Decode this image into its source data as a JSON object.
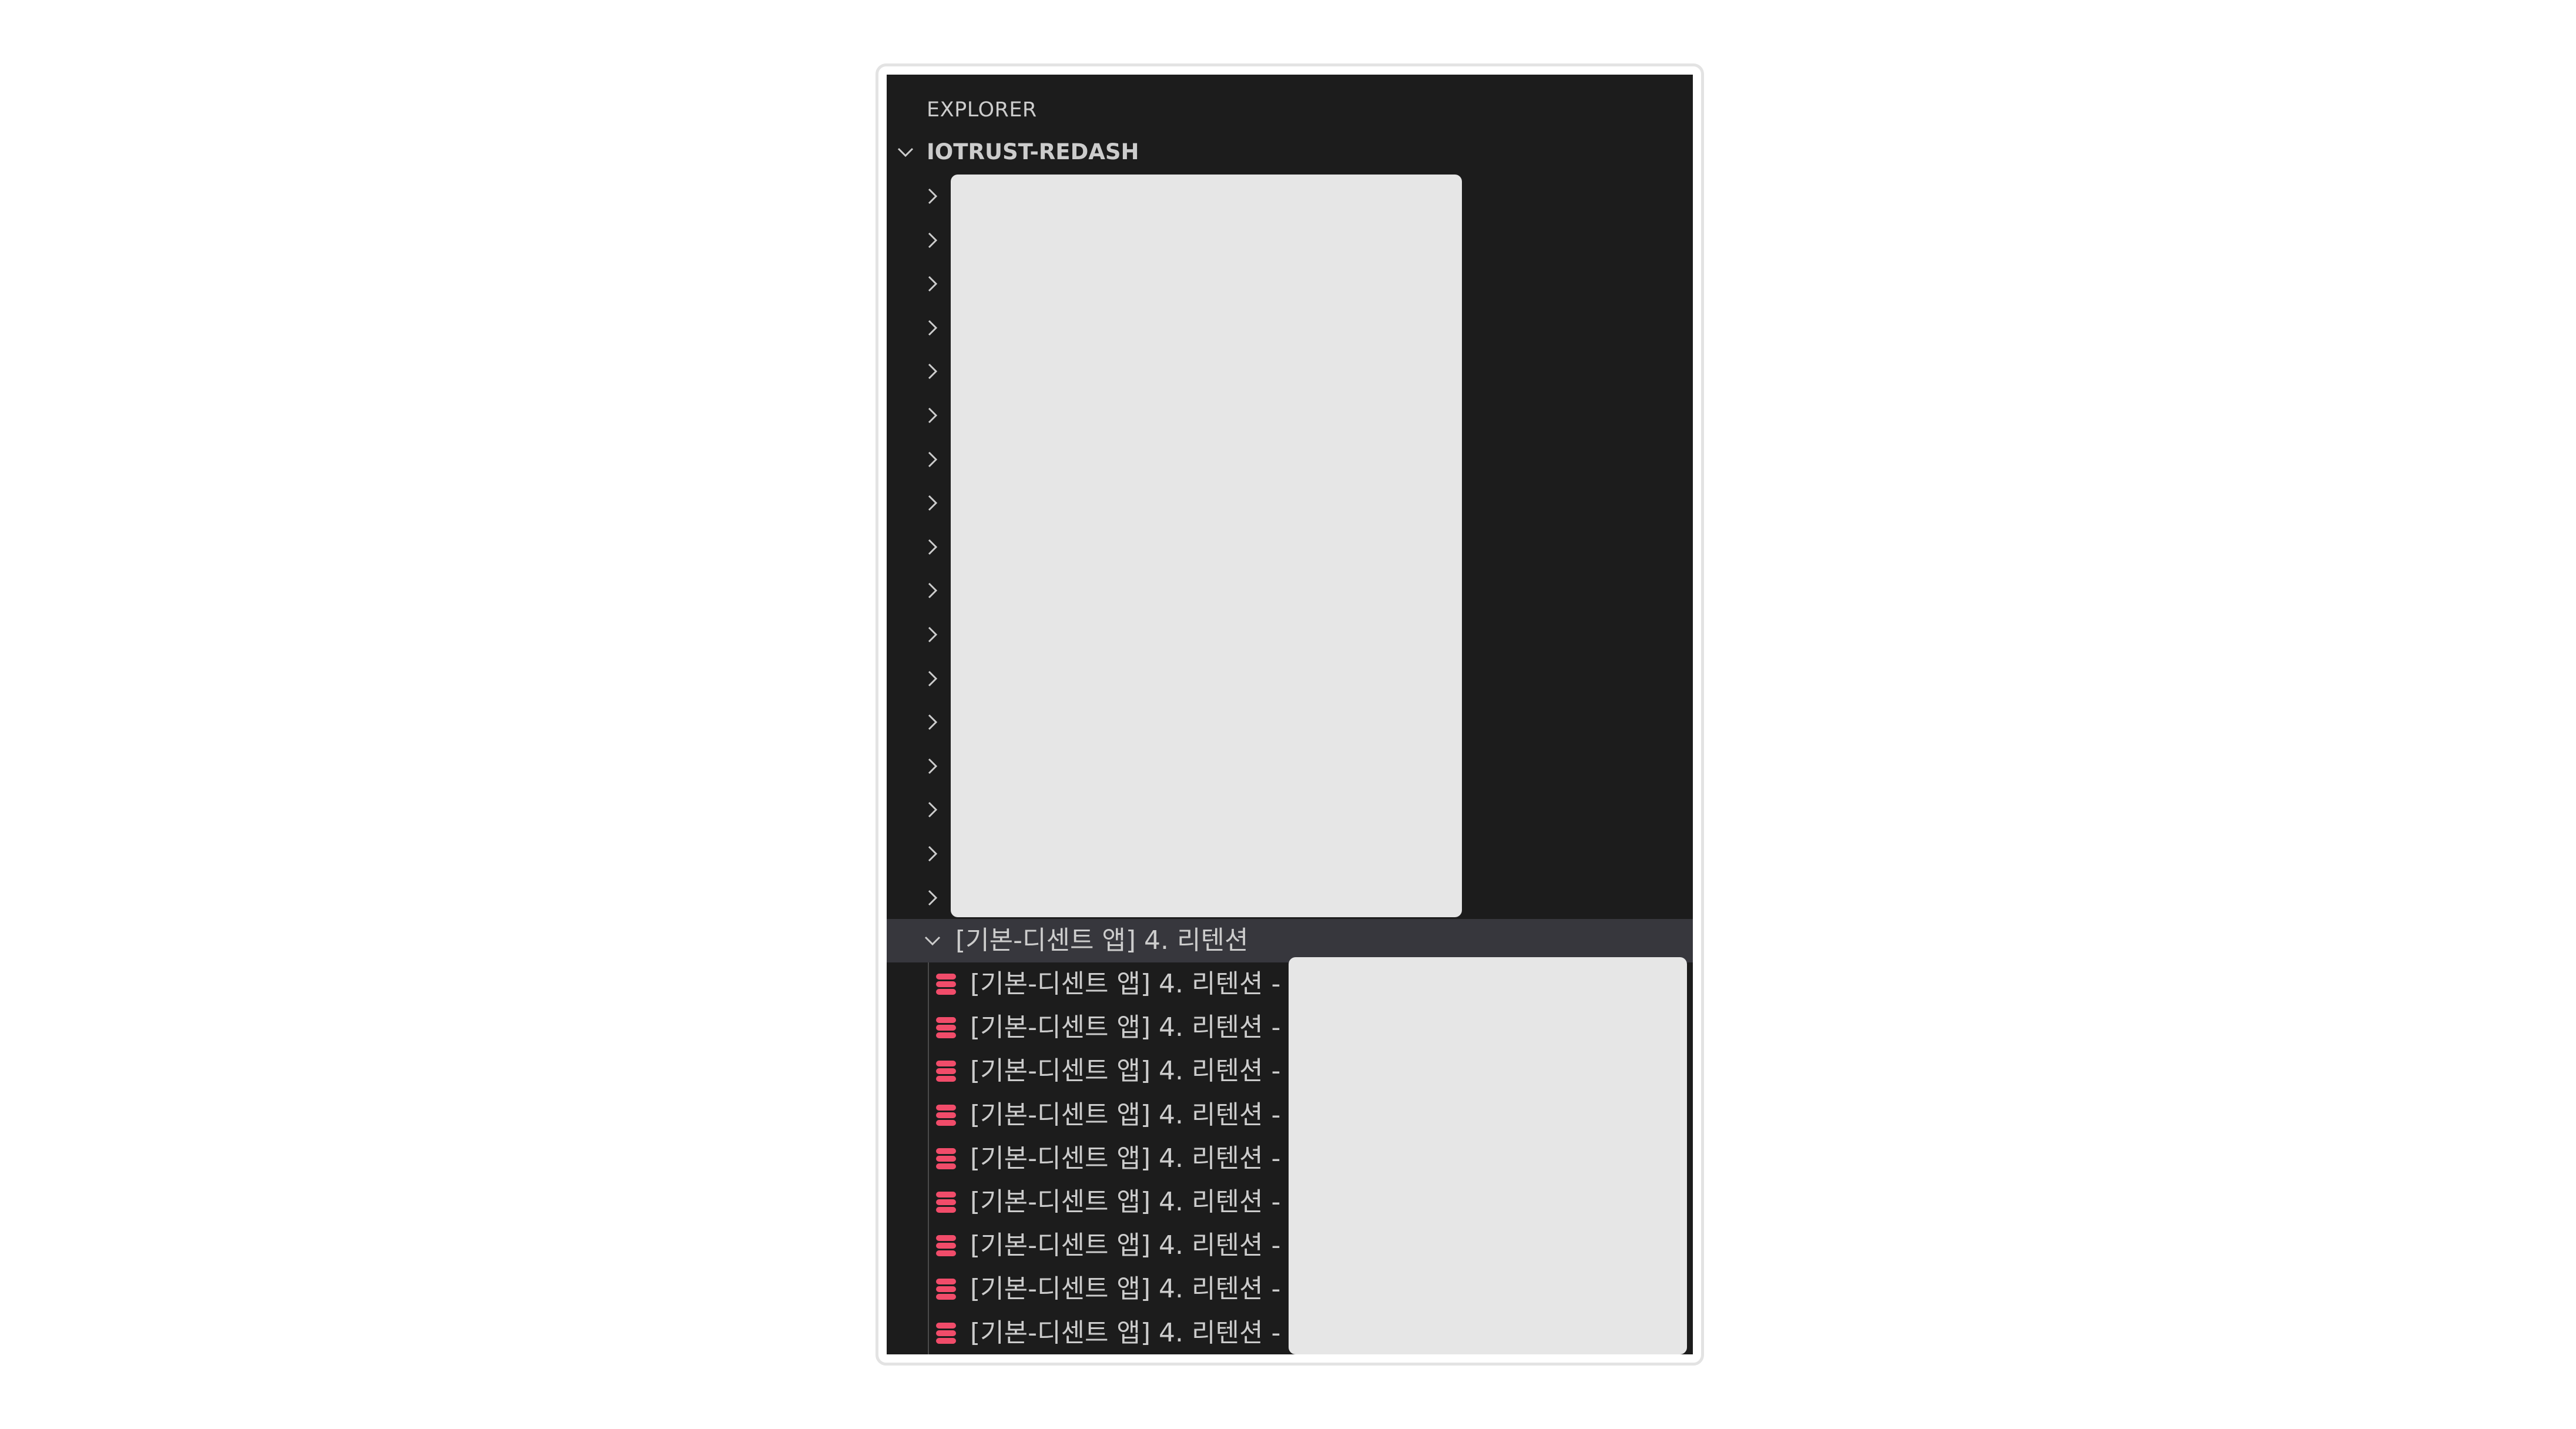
{
  "explorer": {
    "title": "EXPLORER",
    "root": {
      "label": "IOTRUST-REDASH",
      "expanded": true
    },
    "collapsed_folder_count": 17,
    "open_folder": {
      "label": "[기본-디센트 앱] 4. 리텐션",
      "expanded": true,
      "files": [
        {
          "label": "[기본-디센트 앱] 4. 리텐션 -",
          "icon": "database-icon"
        },
        {
          "label": "[기본-디센트 앱] 4. 리텐션 -",
          "icon": "database-icon"
        },
        {
          "label": "[기본-디센트 앱] 4. 리텐션 -",
          "icon": "database-icon"
        },
        {
          "label": "[기본-디센트 앱] 4. 리텐션 -",
          "icon": "database-icon"
        },
        {
          "label": "[기본-디센트 앱] 4. 리텐션 -",
          "icon": "database-icon"
        },
        {
          "label": "[기본-디센트 앱] 4. 리텐션 -",
          "icon": "database-icon"
        },
        {
          "label": "[기본-디센트 앱] 4. 리텐션 -",
          "icon": "database-icon"
        },
        {
          "label": "[기본-디센트 앱] 4. 리텐션 -",
          "icon": "database-icon"
        },
        {
          "label": "[기본-디센트 앱] 4. 리텐션 -",
          "icon": "database-icon"
        }
      ]
    }
  },
  "colors": {
    "panel_bg": "#1c1c1c",
    "selected_row_bg": "#37373d",
    "text": "#cccccc",
    "db_icon": "#f14c6a",
    "redaction": "#e6e6e6"
  }
}
